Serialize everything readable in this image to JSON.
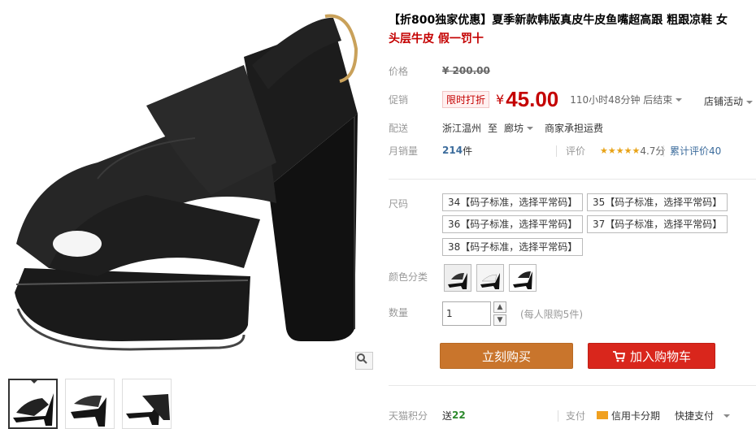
{
  "gallery": {
    "main_image_alt": "black leather high-heel sandal",
    "zoom_icon": "magnifier-icon",
    "thumbnails": [
      {
        "label": ""
      },
      {
        "label": ""
      },
      {
        "label": ""
      }
    ]
  },
  "title": {
    "highlight": "【折800独家优惠】",
    "text": "夏季新款韩版真皮牛皮鱼嘴超高跟 粗跟凉鞋 女",
    "line2": "头层牛皮 假一罚十"
  },
  "price": {
    "label": "价格",
    "currency": "¥",
    "original": "200.00"
  },
  "promo": {
    "label": "促销",
    "tag": "限时打折",
    "currency": "¥",
    "price": "45.00",
    "countdown": "110小时48分钟 后结束",
    "shop_activity": "店铺活动"
  },
  "shipping": {
    "label": "配送",
    "from": "浙江温州",
    "to_word": "至",
    "dest": "廊坊",
    "fee": "商家承担运费"
  },
  "sales": {
    "label": "月销量",
    "count": "214",
    "unit": "件",
    "rating_label": "评价",
    "rating": "4.7分",
    "stars": "★★★★★",
    "reviews": "累计评价40"
  },
  "size": {
    "label": "尺码",
    "options": [
      "34【码子标准，选择平常码】",
      "35【码子标准，选择平常码】",
      "36【码子标准，选择平常码】",
      "37【码子标准，选择平常码】",
      "38【码子标准，选择平常码】"
    ]
  },
  "color": {
    "label": "颜色分类",
    "options": [
      "",
      "",
      ""
    ]
  },
  "quantity": {
    "label": "数量",
    "value": "1",
    "limit": "(每人限购5件)"
  },
  "actions": {
    "buy_now": "立刻购买",
    "add_cart": "加入购物车"
  },
  "footer": {
    "points_label": "天猫积分",
    "points_prefix": "送",
    "points_value": "22",
    "pay_label": "支付",
    "credit": "信用卡分期",
    "quick_pay": "快捷支付"
  },
  "colors": {
    "accent_red": "#c40000",
    "buy_orange": "#c9752c",
    "cart_red": "#d9261c"
  }
}
